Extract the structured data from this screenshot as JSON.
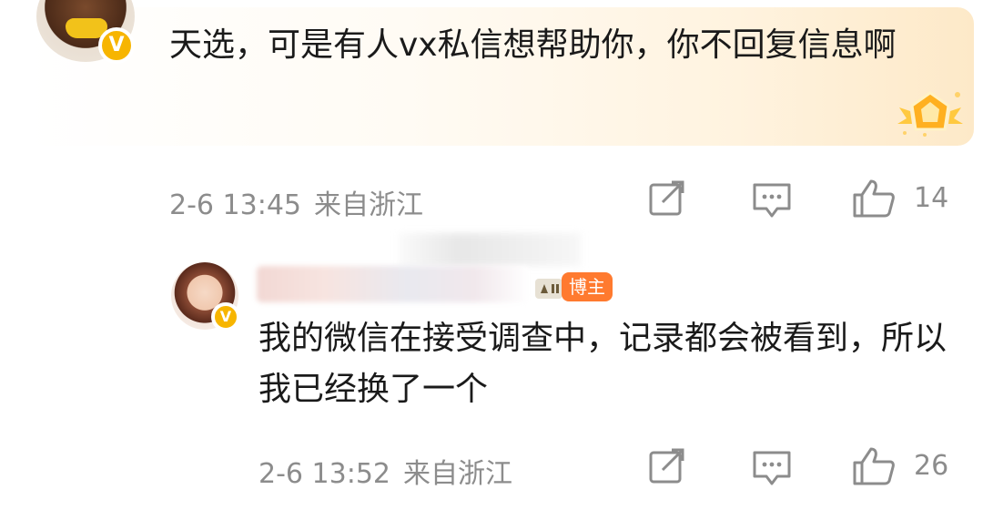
{
  "comment": {
    "text": "天选，可是有人vx私信想帮助你，你不回复信息啊",
    "time": "2-6 13:45",
    "location": "来自浙江",
    "likes": "14",
    "avatar_badge": "V"
  },
  "reply": {
    "author_badge": "博主",
    "text": "我的微信在接受调查中，记录都会被看到，所以我已经换了一个",
    "time": "2-6 13:52",
    "location": "来自浙江",
    "likes": "26",
    "avatar_badge": "V"
  },
  "colors": {
    "meta_text": "#8c8c8c",
    "verified": "#f7b500",
    "blogger_badge": "#ff7a2f"
  }
}
